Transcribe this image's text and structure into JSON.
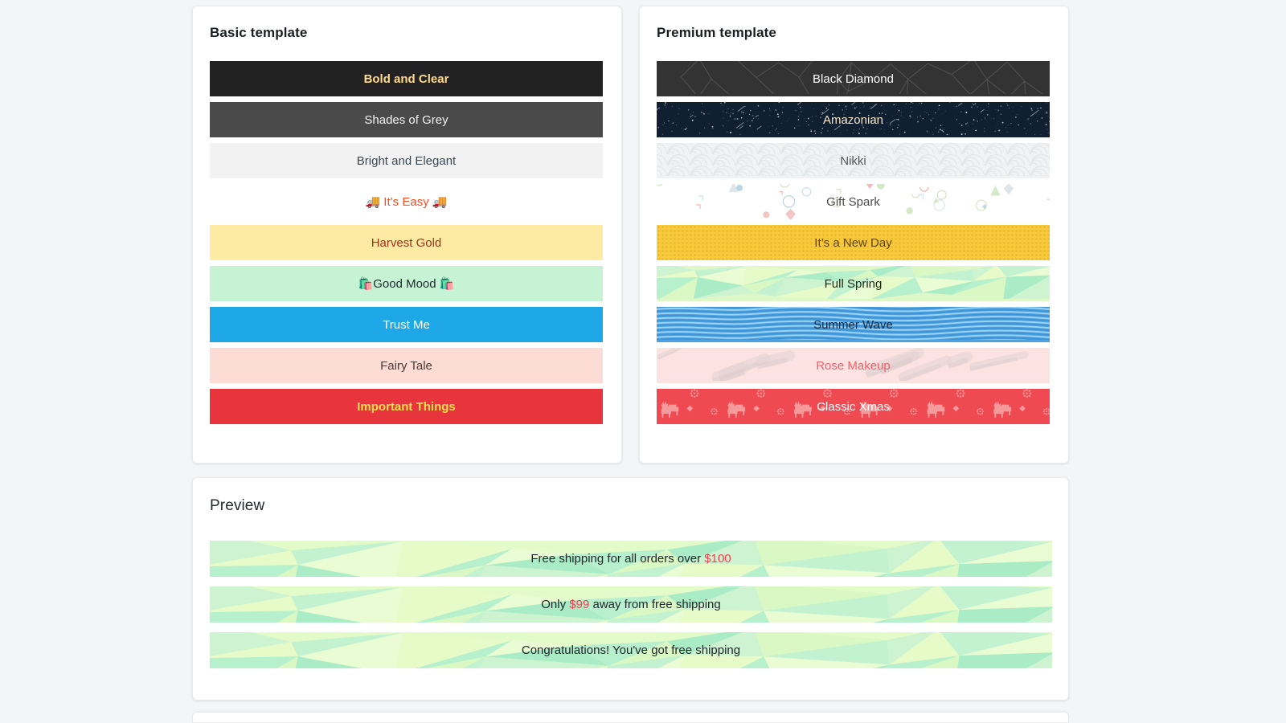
{
  "basic": {
    "title": "Basic template",
    "bars": [
      {
        "name": "bold-and-clear",
        "label": "Bold and Clear",
        "class": "t-bold-clear",
        "bg": "#222222",
        "text": "#ffd98e"
      },
      {
        "name": "shades-of-grey",
        "label": "Shades of Grey",
        "class": "t-shades-grey",
        "bg": "#4a4a4a",
        "text": "#f2f2f2"
      },
      {
        "name": "bright-and-elegant",
        "label": "Bright and Elegant",
        "class": "t-bright-elegant",
        "bg": "#f2f2f2",
        "text": "#3d4852"
      },
      {
        "name": "its-easy",
        "label": "🚚 It’s Easy 🚚",
        "class": "t-its-easy",
        "bg": "#ffffff",
        "text": "#ff4d22"
      },
      {
        "name": "harvest-gold",
        "label": "Harvest Gold",
        "class": "t-harvest-gold",
        "bg": "#fdeaa3",
        "text": "#9e3318"
      },
      {
        "name": "good-mood",
        "label": "🛍️Good Mood 🛍️",
        "class": "t-good-mood",
        "bg": "#c6f3d3",
        "text": "#1f2933"
      },
      {
        "name": "trust-me",
        "label": "Trust Me",
        "class": "t-trust-me",
        "bg": "#1fa8e8",
        "text": "#ffffff"
      },
      {
        "name": "fairy-tale",
        "label": "Fairy Tale",
        "class": "t-fairy-tale",
        "bg": "#fcdcd4",
        "text": "#4a3b38"
      },
      {
        "name": "important-things",
        "label": "Important Things",
        "class": "t-important",
        "bg": "#e8343c",
        "text": "#ffdf4f"
      }
    ]
  },
  "premium": {
    "title": "Premium template",
    "bars": [
      {
        "name": "black-diamond",
        "label": "Black Diamond",
        "class": "t-black-diamond",
        "pattern": "polygon-mesh",
        "bg": "#333333",
        "text": "#ffffff"
      },
      {
        "name": "amazonian",
        "label": "Amazonian",
        "class": "t-amazonian",
        "pattern": "starfield",
        "bg": "#111f33",
        "text": "#f6e7c4"
      },
      {
        "name": "nikki",
        "label": "Nikki",
        "class": "t-nikki",
        "pattern": "seigaiha-scallop",
        "bg": "#f1f2f3",
        "text": "#565656"
      },
      {
        "name": "gift-spark",
        "label": "Gift Spark",
        "class": "t-gift-spark",
        "pattern": "confetti",
        "bg": "#ffffff",
        "text": "#4a4a4a"
      },
      {
        "name": "its-a-new-day",
        "label": "It’s a New Day",
        "class": "t-new-day",
        "pattern": "dots",
        "bg": "#f9c93c",
        "text": "#5e4405"
      },
      {
        "name": "full-spring",
        "label": "Full Spring",
        "class": "t-full-spring",
        "pattern": "low-poly",
        "bg": "#ddf7c8",
        "text": "#1b2b1b"
      },
      {
        "name": "summer-wave",
        "label": "Summer Wave",
        "class": "t-summer-wave",
        "pattern": "waves",
        "bg": "#4ba3e3",
        "text": "#12283d"
      },
      {
        "name": "rose-makeup",
        "label": "Rose Makeup",
        "class": "t-rose-makeup",
        "pattern": "brush-strokes",
        "bg": "#fce3e1",
        "text": "#f4606a"
      },
      {
        "name": "classic-xmas",
        "label": "Classic Xmas",
        "class": "t-classic-xmas",
        "pattern": "nordic-reindeer",
        "bg": "#ef4a52",
        "text": "#ffffff"
      }
    ]
  },
  "preview": {
    "title": "Preview",
    "bars": [
      {
        "name": "preview-free-shipping-threshold",
        "pre": "Free shipping for all orders over ",
        "amount": "$100",
        "post": ""
      },
      {
        "name": "preview-away-from-free-shipping",
        "pre": "Only ",
        "amount": "$99",
        "post": " away from free shipping"
      },
      {
        "name": "preview-congratulations",
        "pre": "Congratulations! You've got free shipping",
        "amount": "",
        "post": ""
      }
    ],
    "accent_color": "#fb3b4e"
  }
}
